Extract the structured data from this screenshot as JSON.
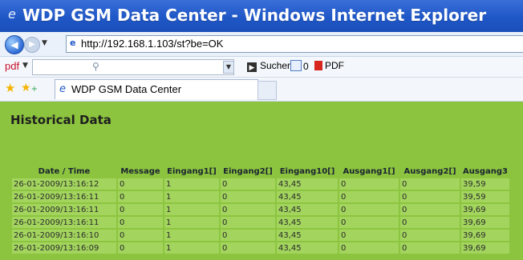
{
  "window": {
    "title": "WDP GSM Data Center - Windows Internet Explorer"
  },
  "address_bar": {
    "url": "http://192.168.1.103/st?be=OK"
  },
  "pdf_toolbar": {
    "label": "pdf",
    "search_label": "Suchen",
    "count_label": "0",
    "pdf_button_label": "PDF"
  },
  "tabs": [
    {
      "label": "WDP GSM Data Center",
      "active": true
    }
  ],
  "page": {
    "heading": "Historical Data",
    "background_color": "#8cc43f",
    "cell_color": "#a3d55e"
  },
  "table": {
    "headers": [
      "Date / Time",
      "Message",
      "Eingang1[]",
      "Eingang2[]",
      "Eingang10[]",
      "Ausgang1[]",
      "Ausgang2[]",
      "Ausgang3"
    ],
    "rows": [
      [
        "26-01-2009/13:16:12",
        "0",
        "1",
        "0",
        "43,45",
        "0",
        "0",
        "39,59"
      ],
      [
        "26-01-2009/13:16:11",
        "0",
        "1",
        "0",
        "43,45",
        "0",
        "0",
        "39,59"
      ],
      [
        "26-01-2009/13:16:11",
        "0",
        "1",
        "0",
        "43,45",
        "0",
        "0",
        "39,69"
      ],
      [
        "26-01-2009/13:16:11",
        "0",
        "1",
        "0",
        "43,45",
        "0",
        "0",
        "39,69"
      ],
      [
        "26-01-2009/13:16:10",
        "0",
        "1",
        "0",
        "43,45",
        "0",
        "0",
        "39,69"
      ],
      [
        "26-01-2009/13:16:09",
        "0",
        "1",
        "0",
        "43,45",
        "0",
        "0",
        "39,69"
      ]
    ]
  }
}
